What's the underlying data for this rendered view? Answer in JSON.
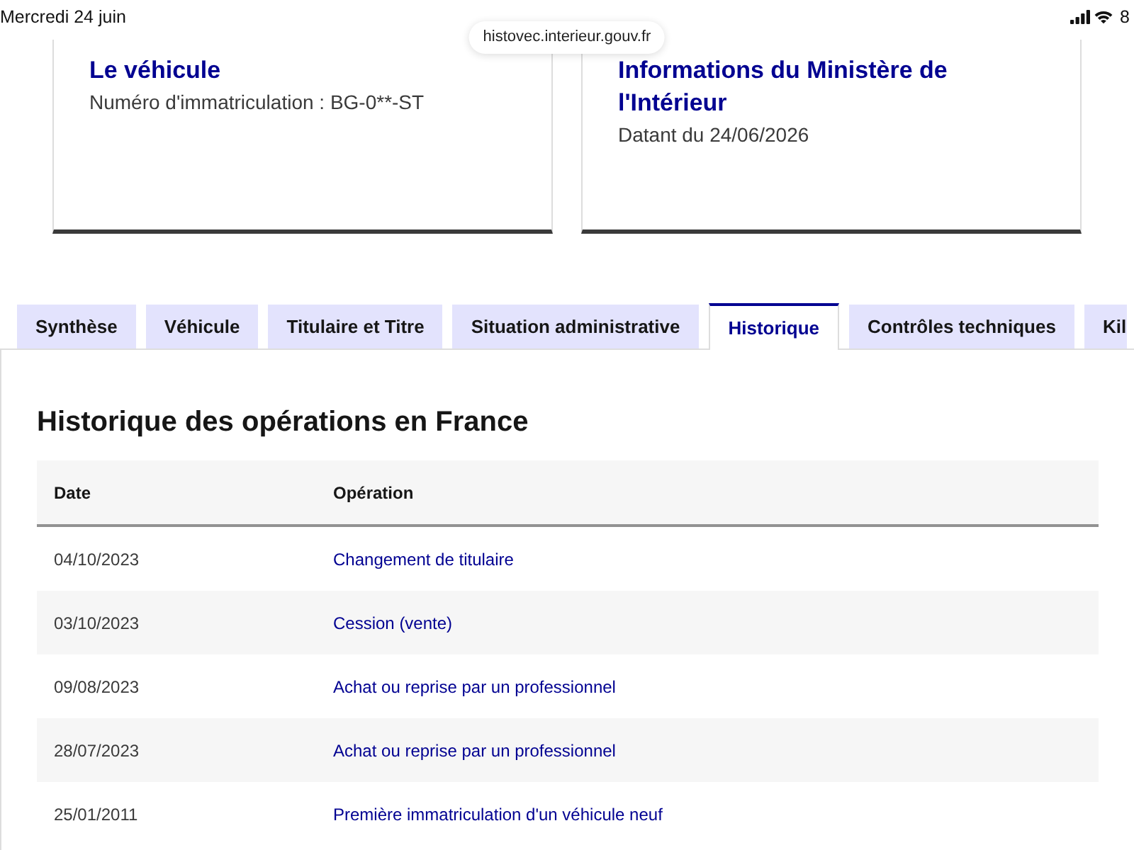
{
  "status_bar": {
    "date": "Mercredi 24 juin",
    "url": "histovec.interieur.gouv.fr",
    "battery": "8"
  },
  "cards": [
    {
      "title": "Le véhicule",
      "text": "Numéro d'immatriculation : BG-0**-ST"
    },
    {
      "title": "Informations du Ministère de l'Intérieur",
      "text": "Datant du 24/06/2026"
    }
  ],
  "tabs": [
    {
      "label": "Synthèse",
      "selected": false
    },
    {
      "label": "Véhicule",
      "selected": false
    },
    {
      "label": "Titulaire et Titre",
      "selected": false
    },
    {
      "label": "Situation administrative",
      "selected": false
    },
    {
      "label": "Historique",
      "selected": true
    },
    {
      "label": "Contrôles techniques",
      "selected": false
    },
    {
      "label": "Kil",
      "selected": false
    }
  ],
  "section": {
    "title": "Historique des opérations en France",
    "table": {
      "columns": [
        "Date",
        "Opération"
      ],
      "rows": [
        {
          "date": "04/10/2023",
          "operation": "Changement de titulaire"
        },
        {
          "date": "03/10/2023",
          "operation": "Cession (vente)"
        },
        {
          "date": "09/08/2023",
          "operation": "Achat ou reprise par un professionnel"
        },
        {
          "date": "28/07/2023",
          "operation": "Achat ou reprise par un professionnel"
        },
        {
          "date": "25/01/2011",
          "operation": "Première immatriculation d'un véhicule neuf"
        }
      ]
    }
  }
}
